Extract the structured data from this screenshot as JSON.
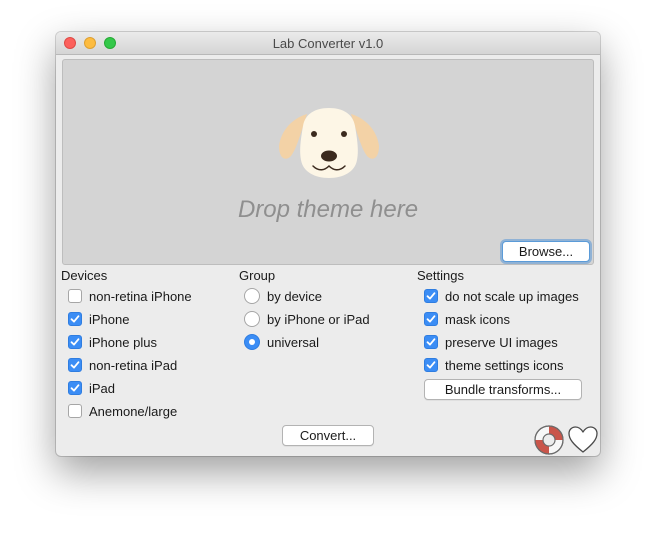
{
  "window": {
    "title": "Lab Converter v1.0"
  },
  "drop_zone": {
    "text": "Drop theme here",
    "browse_label": "Browse..."
  },
  "devices": {
    "label": "Devices",
    "items": [
      {
        "label": "non-retina iPhone",
        "checked": false
      },
      {
        "label": "iPhone",
        "checked": true
      },
      {
        "label": "iPhone plus",
        "checked": true
      },
      {
        "label": "non-retina iPad",
        "checked": true
      },
      {
        "label": "iPad",
        "checked": true
      },
      {
        "label": "Anemone/large",
        "checked": false
      }
    ]
  },
  "group": {
    "label": "Group",
    "items": [
      {
        "label": "by device",
        "selected": false
      },
      {
        "label": "by iPhone or iPad",
        "selected": false
      },
      {
        "label": "universal",
        "selected": true
      }
    ]
  },
  "settings": {
    "label": "Settings",
    "items": [
      {
        "label": "do not scale up images",
        "checked": true
      },
      {
        "label": "mask icons",
        "checked": true
      },
      {
        "label": "preserve UI images",
        "checked": true
      },
      {
        "label": "theme settings icons",
        "checked": true
      }
    ],
    "bundle_transforms_label": "Bundle transforms..."
  },
  "convert_label": "Convert...",
  "icons": {
    "lifebuoy": "lifebuoy-icon",
    "heart": "heart-icon",
    "dog": "dog-face-icon"
  },
  "colors": {
    "accent": "#3b8df5",
    "drop_zone": "#d4d4d4",
    "window_bg": "#ececec"
  }
}
